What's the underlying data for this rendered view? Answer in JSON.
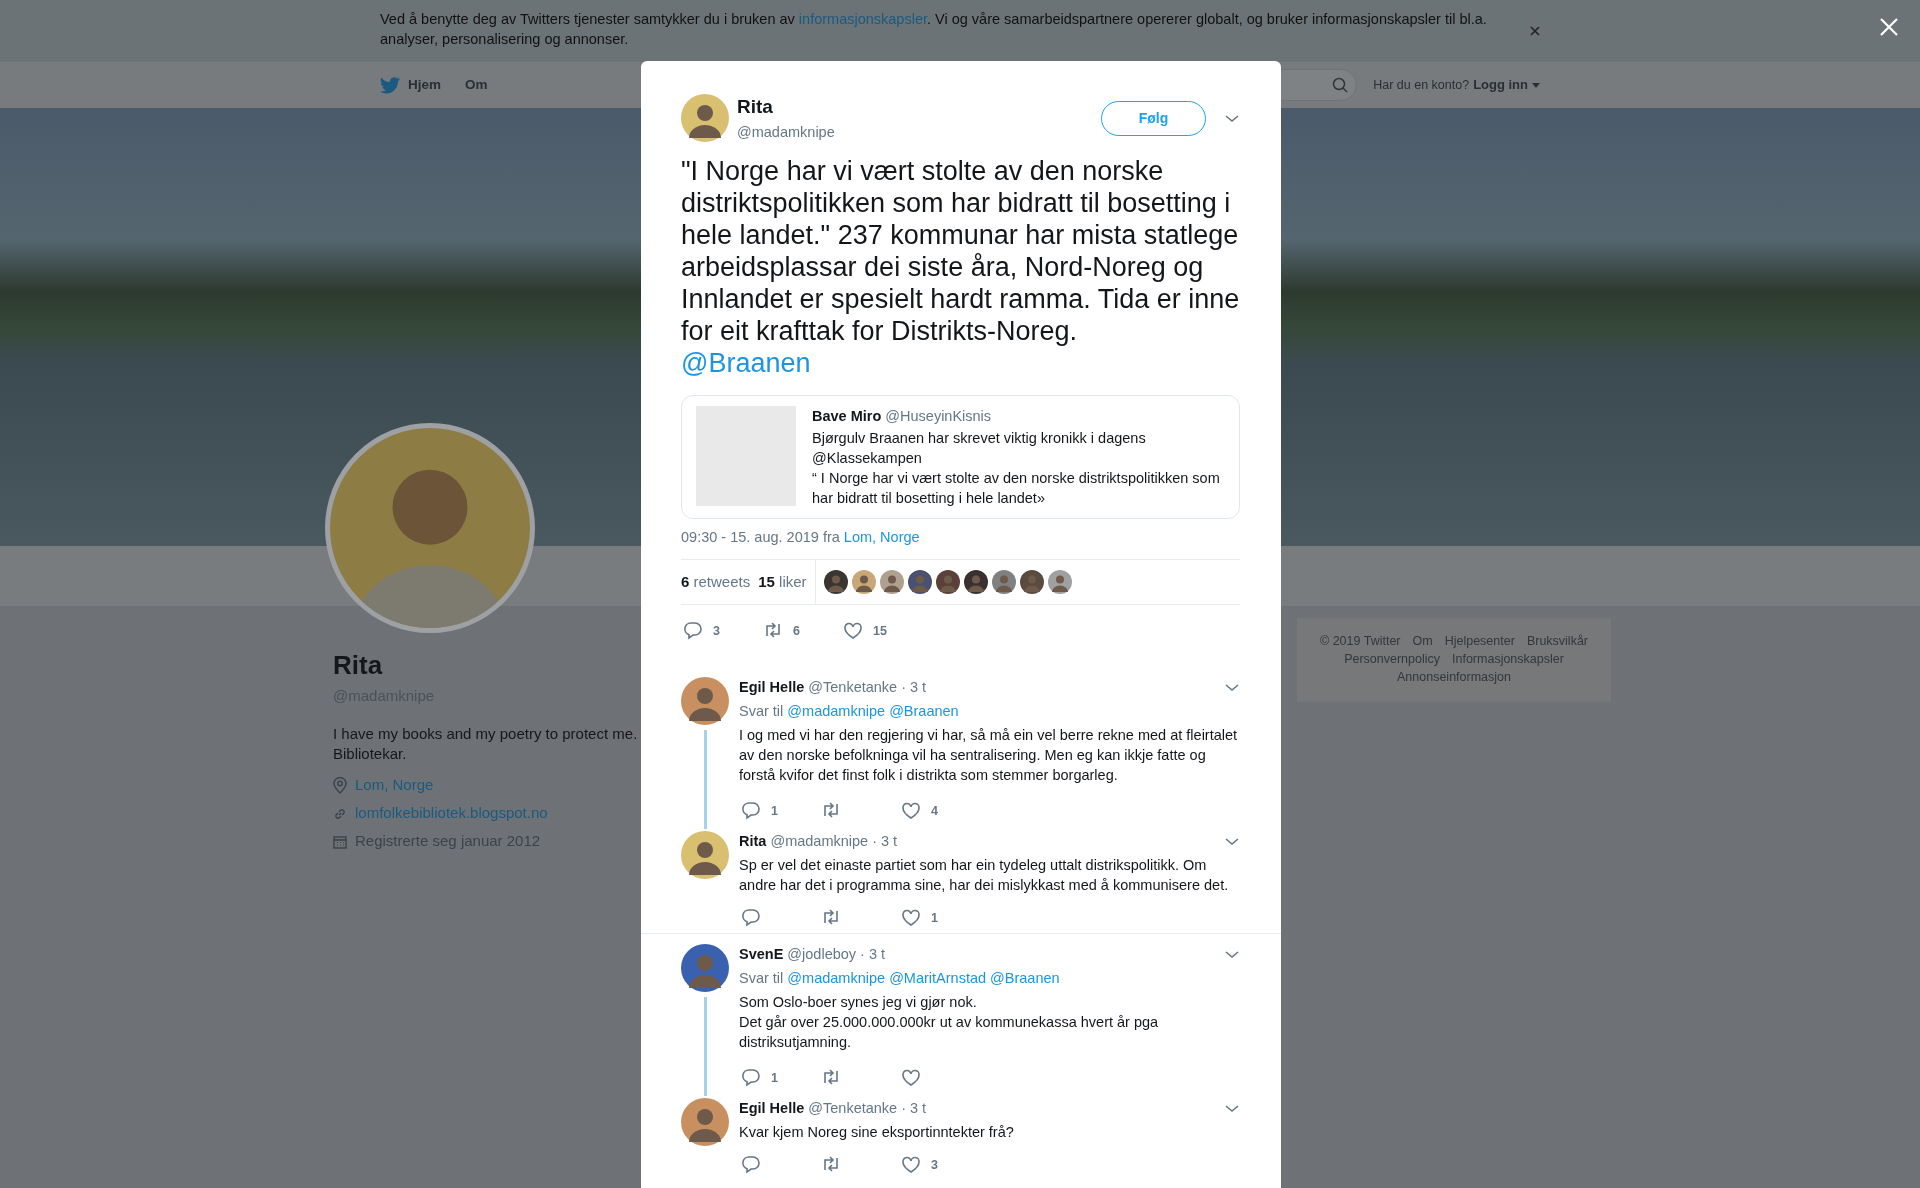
{
  "cookie_banner": {
    "text_before": "Ved å benytte deg av Twitters tjenester samtykker du i bruken av ",
    "link": "informasjonskapsler",
    "text_after": ". Vi og våre samarbeidspartnere opererer globalt, og bruker informasjonskapsler til bl.a. analyser, personalisering og annonser."
  },
  "nav": {
    "items": [
      {
        "label": "Hjem",
        "kind": "home"
      },
      {
        "label": "Om",
        "kind": "plain"
      }
    ],
    "login_prompt": "Har du en konto?",
    "login_link": "Logg inn"
  },
  "profile": {
    "name": "Rita",
    "handle": "@madamknipe",
    "bio": "I have my books and my poetry to protect me. Bibliotekar.",
    "location": "Lom, Norge",
    "website": "lomfolkebibliotek.blogspot.no",
    "joined": "Registrerte seg januar 2012"
  },
  "footer_links": [
    "© 2019 Twitter",
    "Om",
    "Hjelpesenter",
    "Bruksvilkår",
    "Personvernpolicy",
    "Informasjonskapsler",
    "Annonseinformasjon"
  ],
  "tweet": {
    "name": "Rita",
    "handle": "@madamknipe",
    "follow_button": "Følg",
    "text": "\"I Norge har vi vært stolte av den norske distriktspolitikken som har bidratt til bosetting i hele landet.\" 237 kommunar har mista statlege arbeidsplassar dei siste åra, Nord-Noreg og Innlandet er spesielt hardt ramma. Tida er inne for eit krafttak for Distrikts-Noreg.",
    "mention": "@Braanen",
    "quoted": {
      "name": "Bave Miro",
      "handle": "@HuseyinKisnis",
      "text": "Bjørgulv Braanen har skrevet viktig kronikk i dagens @Klassekampen\n“ I Norge har vi vært stolte av den norske distriktspolitikken som har bidratt til bosetting i hele landet»"
    },
    "timestamp": "09:30 - 15. aug. 2019 fra",
    "place": "Lom, Norge",
    "retweets_count": "6",
    "retweets_label": "retweets",
    "likes_count": "15",
    "likes_label": "liker",
    "counts": {
      "reply": "3",
      "retweet": "6",
      "like": "15"
    }
  },
  "conversations": [
    {
      "replies": [
        {
          "name": "Egil Helle",
          "handle": "@Tenketanke",
          "time": "· 3 t",
          "reply_label": "Svar til",
          "reply_to": [
            "@madamknipe",
            "@Braanen"
          ],
          "text": "I og med vi har den regjering vi har, så må ein vel berre rekne med at fleirtalet av den norske befolkninga vil ha sentralisering. Men eg kan ikkje fatte og forstå kvifor det finst folk i distrikta som stemmer borgarleg.",
          "counts": {
            "reply": "1",
            "like": "4"
          }
        },
        {
          "name": "Rita",
          "handle": "@madamknipe",
          "time": "· 3 t",
          "text": "Sp er vel det einaste partiet som har ein tydeleg uttalt distrikspolitikk. Om andre har det i programma sine, har dei mislykkast med å kommunisere det.",
          "counts": {
            "like": "1"
          }
        }
      ]
    },
    {
      "replies": [
        {
          "name": "SvenE",
          "handle": "@jodleboy",
          "time": "· 3 t",
          "reply_label": "Svar til",
          "reply_to": [
            "@madamknipe",
            "@MaritArnstad",
            "@Braanen"
          ],
          "text": "Som Oslo-boer synes jeg vi gjør nok.\nDet går over 25.000.000.000kr ut av kommunekassa hvert år pga distriksutjamning.",
          "counts": {
            "reply": "1"
          }
        },
        {
          "name": "Egil Helle",
          "handle": "@Tenketanke",
          "time": "· 3 t",
          "text": "Kvar kjem Noreg sine eksportinntekter frå?",
          "counts": {
            "like": "3"
          }
        }
      ]
    }
  ]
}
